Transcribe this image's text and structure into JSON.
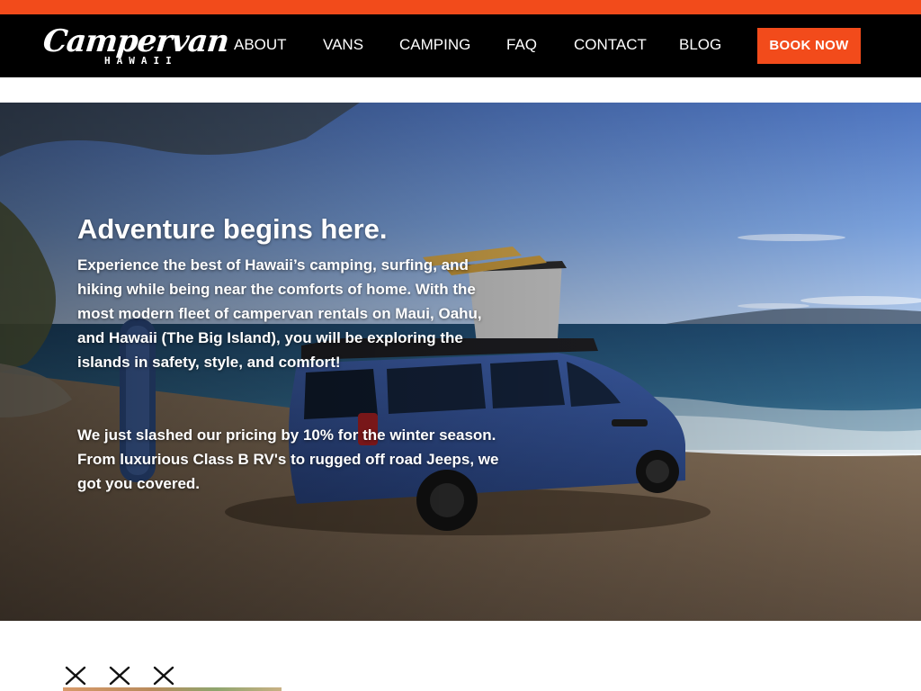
{
  "brand": {
    "accent": "#f24b1b",
    "nav_bg": "#000000",
    "logo_script": "Campervan",
    "logo_sub": "HAWAII"
  },
  "nav": {
    "items": [
      {
        "label": "ABOUT"
      },
      {
        "label": "VANS"
      },
      {
        "label": "CAMPING"
      },
      {
        "label": "FAQ"
      },
      {
        "label": "CONTACT"
      },
      {
        "label": "BLOG"
      }
    ],
    "cta_label": "BOOK NOW"
  },
  "hero": {
    "title": "Adventure begins here.",
    "paragraph1": "Experience the best of Hawaii’s camping, surfing, and hiking while being near the comforts of home. With the most modern fleet of campervan rentals on Maui, Oahu, and Hawaii (The Big Island), you will be exploring the islands in safety, style, and comfort!",
    "paragraph2": "We just slashed our pricing by 10% for the winter season.  From luxurious Class B RV's to rugged off road Jeeps, we got you covered."
  },
  "icons": {
    "logo": "campervan-hawaii-logo",
    "decor": "x-mark-icon"
  }
}
